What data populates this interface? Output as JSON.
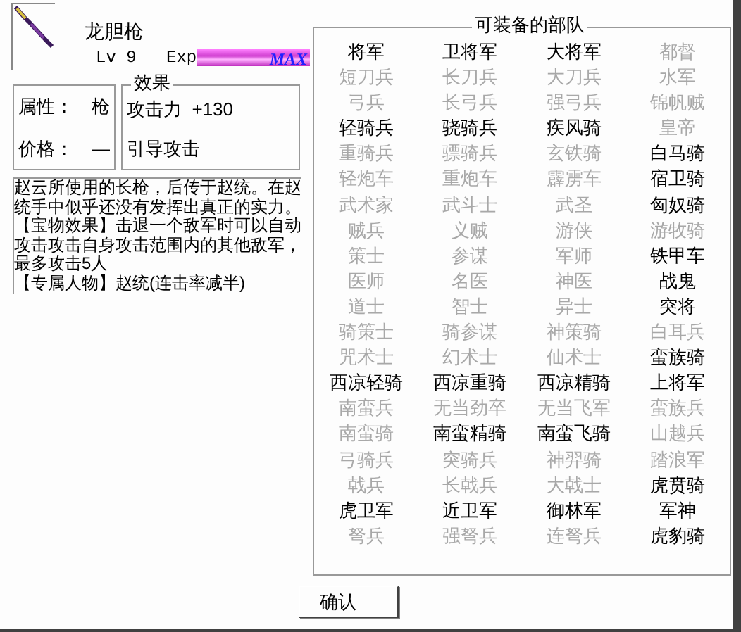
{
  "item": {
    "name": "龙胆枪",
    "level_label": "Lv",
    "level": "9",
    "exp_label": "Exp",
    "exp_bar": {
      "level": 1,
      "text": "MAX"
    }
  },
  "properties": [
    {
      "label": "属性：",
      "value": "枪"
    },
    {
      "label": "价格：",
      "value": "—"
    }
  ],
  "effects": {
    "title": "效果",
    "lines": [
      "攻击力  +130",
      "引导攻击"
    ]
  },
  "description": [
    "赵云所使用的长枪，后传于赵统。在赵统手中似乎还没有发挥出真正的实力。",
    "【宝物效果】击退一个敌军时可以自动攻击攻击自身攻击范围内的其他敌军，最多攻击5人",
    "【专属人物】赵统(连击率减半)"
  ],
  "units": {
    "title": "可装备的部队",
    "items": [
      {
        "name": "将军",
        "available": true
      },
      {
        "name": "卫将军",
        "available": true
      },
      {
        "name": "大将军",
        "available": true
      },
      {
        "name": "都督",
        "available": false
      },
      {
        "name": "短刀兵",
        "available": false
      },
      {
        "name": "长刀兵",
        "available": false
      },
      {
        "name": "大刀兵",
        "available": false
      },
      {
        "name": "水军",
        "available": false
      },
      {
        "name": "弓兵",
        "available": false
      },
      {
        "name": "长弓兵",
        "available": false
      },
      {
        "name": "强弓兵",
        "available": false
      },
      {
        "name": "锦帆贼",
        "available": false
      },
      {
        "name": "轻骑兵",
        "available": true
      },
      {
        "name": "骁骑兵",
        "available": true
      },
      {
        "name": "疾风骑",
        "available": true
      },
      {
        "name": "皇帝",
        "available": false
      },
      {
        "name": "重骑兵",
        "available": false
      },
      {
        "name": "骠骑兵",
        "available": false
      },
      {
        "name": "玄铁骑",
        "available": false
      },
      {
        "name": "白马骑",
        "available": true
      },
      {
        "name": "轻炮车",
        "available": false
      },
      {
        "name": "重炮车",
        "available": false
      },
      {
        "name": "霹雳车",
        "available": false
      },
      {
        "name": "宿卫骑",
        "available": true
      },
      {
        "name": "武术家",
        "available": false
      },
      {
        "name": "武斗士",
        "available": false
      },
      {
        "name": "武圣",
        "available": false
      },
      {
        "name": "匈奴骑",
        "available": true
      },
      {
        "name": "贼兵",
        "available": false
      },
      {
        "name": "义贼",
        "available": false
      },
      {
        "name": "游侠",
        "available": false
      },
      {
        "name": "游牧骑",
        "available": false
      },
      {
        "name": "策士",
        "available": false
      },
      {
        "name": "参谋",
        "available": false
      },
      {
        "name": "军师",
        "available": false
      },
      {
        "name": "铁甲车",
        "available": true
      },
      {
        "name": "医师",
        "available": false
      },
      {
        "name": "名医",
        "available": false
      },
      {
        "name": "神医",
        "available": false
      },
      {
        "name": "战鬼",
        "available": true
      },
      {
        "name": "道士",
        "available": false
      },
      {
        "name": "智士",
        "available": false
      },
      {
        "name": "异士",
        "available": false
      },
      {
        "name": "突将",
        "available": true
      },
      {
        "name": "骑策士",
        "available": false
      },
      {
        "name": "骑参谋",
        "available": false
      },
      {
        "name": "神策骑",
        "available": false
      },
      {
        "name": "白耳兵",
        "available": false
      },
      {
        "name": "咒术士",
        "available": false
      },
      {
        "name": "幻术士",
        "available": false
      },
      {
        "name": "仙术士",
        "available": false
      },
      {
        "name": "蛮族骑",
        "available": true
      },
      {
        "name": "西凉轻骑",
        "available": true
      },
      {
        "name": "西凉重骑",
        "available": true
      },
      {
        "name": "西凉精骑",
        "available": true
      },
      {
        "name": "上将军",
        "available": true
      },
      {
        "name": "南蛮兵",
        "available": false
      },
      {
        "name": "无当劲卒",
        "available": false
      },
      {
        "name": "无当飞军",
        "available": false
      },
      {
        "name": "蛮族兵",
        "available": false
      },
      {
        "name": "南蛮骑",
        "available": false
      },
      {
        "name": "南蛮精骑",
        "available": true
      },
      {
        "name": "南蛮飞骑",
        "available": true
      },
      {
        "name": "山越兵",
        "available": false
      },
      {
        "name": "弓骑兵",
        "available": false
      },
      {
        "name": "突骑兵",
        "available": false
      },
      {
        "name": "神羿骑",
        "available": false
      },
      {
        "name": "踏浪军",
        "available": false
      },
      {
        "name": "戟兵",
        "available": false
      },
      {
        "name": "长戟兵",
        "available": false
      },
      {
        "name": "大戟士",
        "available": false
      },
      {
        "name": "虎贲骑",
        "available": true
      },
      {
        "name": "虎卫军",
        "available": true
      },
      {
        "name": "近卫军",
        "available": true
      },
      {
        "name": "御林军",
        "available": true
      },
      {
        "name": "军神",
        "available": true
      },
      {
        "name": "弩兵",
        "available": false
      },
      {
        "name": "强弩兵",
        "available": false
      },
      {
        "name": "连弩兵",
        "available": false
      },
      {
        "name": "虎豹骑",
        "available": true
      }
    ]
  },
  "buttons": [
    "确认"
  ]
}
